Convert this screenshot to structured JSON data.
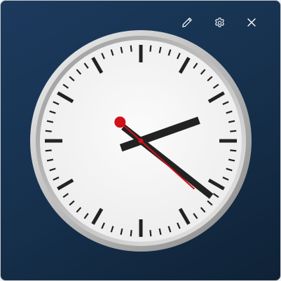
{
  "widget": {
    "type": "analog clock",
    "colors": {
      "background_top": "#1c3a5e",
      "background_bottom": "#0f2236",
      "bezel": "#c9c9c9",
      "dial": "#f2f2f2",
      "hands": "#222222",
      "second_hand": "#d0101a",
      "toolbar_icons": "#ffffff"
    }
  },
  "toolbar": {
    "items": [
      {
        "icon": "pen-icon",
        "action": "edit style"
      },
      {
        "icon": "gear-icon",
        "action": "settings"
      },
      {
        "icon": "close-icon",
        "action": "close"
      }
    ]
  },
  "clock": {
    "time": {
      "hours": 2,
      "minutes": 21,
      "seconds": 22
    },
    "markers": {
      "hour_ticks": 12,
      "minute_ticks": 60
    }
  }
}
